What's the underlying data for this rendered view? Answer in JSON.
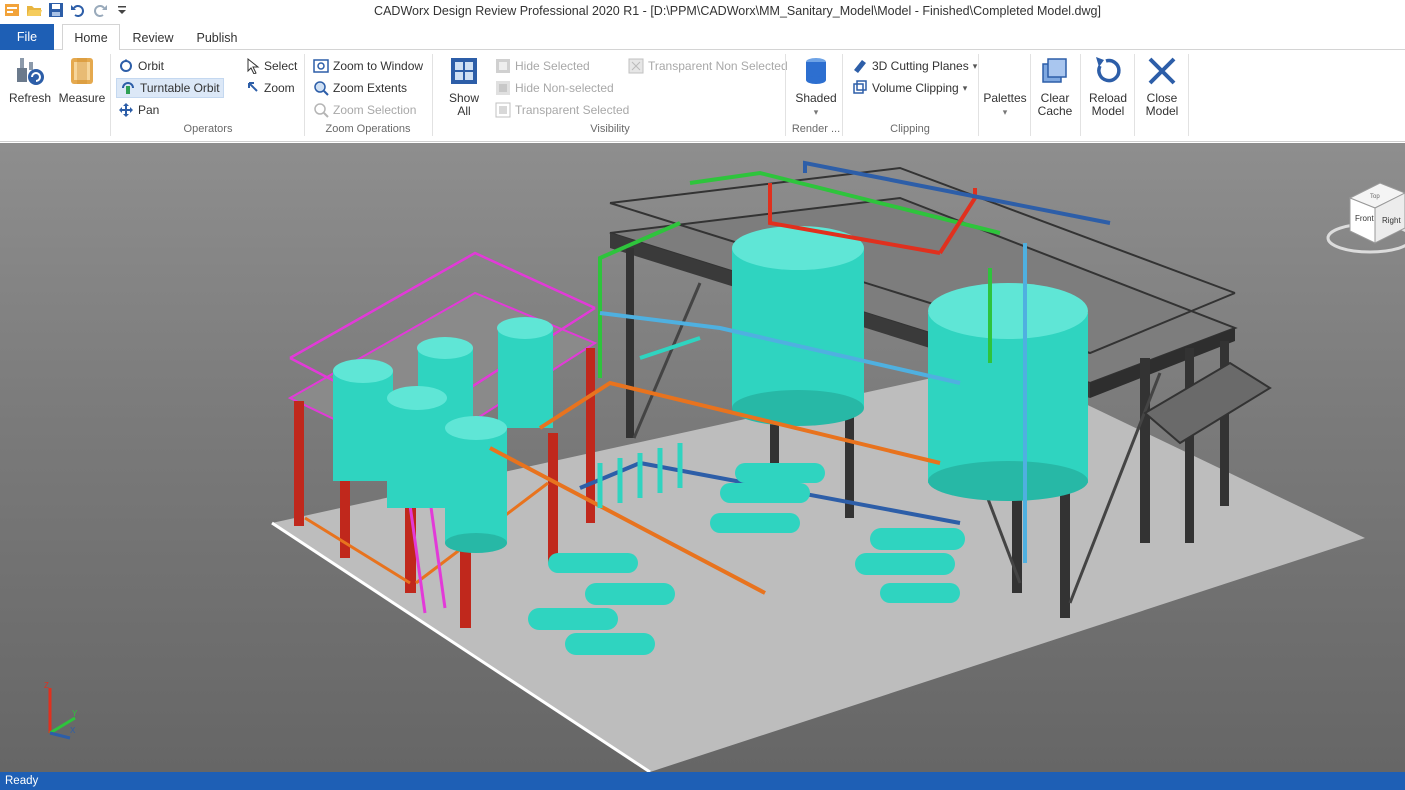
{
  "window": {
    "title": "CADWorx Design Review Professional 2020 R1 - [D:\\PPM\\CADWorx\\MM_Sanitary_Model\\Model - Finished\\Completed Model.dwg]"
  },
  "quick_access": {
    "icons": [
      "app-icon",
      "open-icon",
      "save-icon",
      "undo-icon",
      "redo-icon",
      "customize-dropdown-icon"
    ]
  },
  "tabs": {
    "file": "File",
    "items": [
      {
        "label": "Home",
        "active": true
      },
      {
        "label": "Review",
        "active": false
      },
      {
        "label": "Publish",
        "active": false
      }
    ]
  },
  "ribbon": {
    "refresh": "Refresh",
    "measure": "Measure",
    "orbit": "Orbit",
    "turntable_orbit": "Turntable Orbit",
    "pan": "Pan",
    "select": "Select",
    "zoom": "Zoom",
    "operators_label": "Operators",
    "zoom_to_window": "Zoom to Window",
    "zoom_extents": "Zoom Extents",
    "zoom_selection": "Zoom Selection",
    "zoom_operations_label": "Zoom Operations",
    "show_all_line1": "Show",
    "show_all_line2": "All",
    "hide_selected": "Hide Selected",
    "hide_non_selected": "Hide Non-selected",
    "transparent_selected": "Transparent Selected",
    "transparent_non_selected": "Transparent Non Selected",
    "visibility_label": "Visibility",
    "shaded": "Shaded",
    "render_label": "Render ...",
    "cutting_planes": "3D Cutting Planes",
    "volume_clipping": "Volume Clipping",
    "clipping_label": "Clipping",
    "palettes": "Palettes",
    "clear_cache_line1": "Clear",
    "clear_cache_line2": "Cache",
    "reload_model_line1": "Reload",
    "reload_model_line2": "Model",
    "close_model_line1": "Close",
    "close_model_line2": "Model"
  },
  "viewcube": {
    "front": "Front",
    "right": "Right",
    "top": "Top"
  },
  "axis": {
    "x": "X",
    "y": "Y",
    "z": "Z"
  },
  "status": {
    "text": "Ready"
  },
  "colors": {
    "accent": "#1e5fb5",
    "tank": "#2fd4c0",
    "pipe_red": "#e0301e",
    "pipe_green": "#2ec43c",
    "pipe_orange": "#e8731e",
    "pipe_magenta": "#e23ad8",
    "structure_dark": "#3a3a3a"
  }
}
